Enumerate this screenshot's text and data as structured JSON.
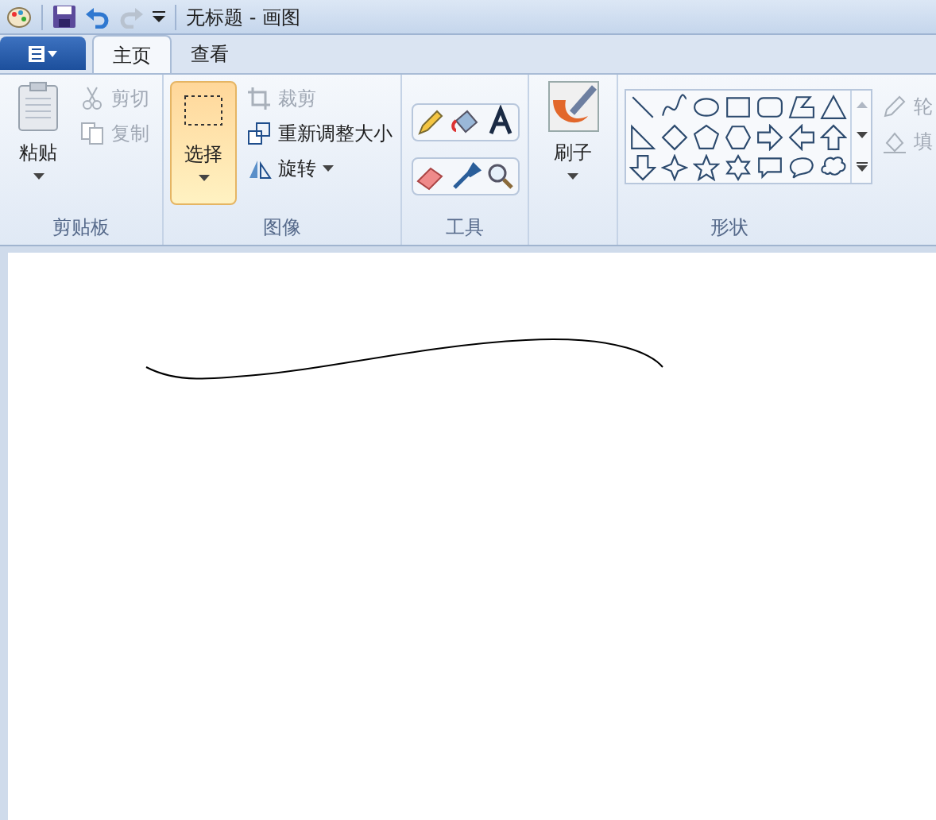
{
  "window": {
    "title": "无标题 - 画图"
  },
  "tabs": [
    {
      "label": "主页",
      "selected": true
    },
    {
      "label": "查看",
      "selected": false
    }
  ],
  "ribbon": {
    "clipboard": {
      "label": "剪贴板",
      "paste": "粘贴",
      "items": [
        {
          "label": "剪切",
          "disabled": true,
          "kind": "cut"
        },
        {
          "label": "复制",
          "disabled": true,
          "kind": "copy"
        }
      ]
    },
    "image": {
      "label": "图像",
      "select": {
        "label": "选择",
        "selected": true
      },
      "items": [
        {
          "label": "裁剪",
          "disabled": true,
          "kind": "crop",
          "dropdown": false
        },
        {
          "label": "重新调整大小",
          "disabled": false,
          "kind": "resize",
          "dropdown": false
        },
        {
          "label": "旋转",
          "disabled": false,
          "kind": "rotate",
          "dropdown": true
        }
      ]
    },
    "tools": {
      "label": "工具"
    },
    "brushes": {
      "label": "刷子"
    },
    "shapes": {
      "label": "形状",
      "items": [
        {
          "label": "轮",
          "disabled": true,
          "kind": "outline"
        },
        {
          "label": "填",
          "disabled": true,
          "kind": "fill"
        }
      ]
    }
  }
}
